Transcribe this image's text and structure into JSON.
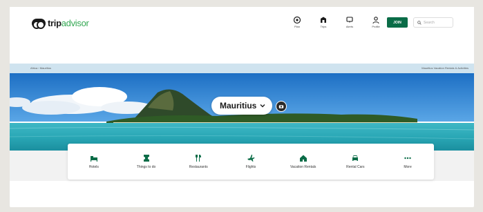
{
  "brand": {
    "name_main": "trip",
    "name_accent": "advisor"
  },
  "nav": [
    {
      "label": "Plan",
      "icon": "plan-icon"
    },
    {
      "label": "Trips",
      "icon": "trips-icon"
    },
    {
      "label": "Alerts",
      "icon": "alerts-icon"
    },
    {
      "label": "Profile",
      "icon": "profile-icon"
    }
  ],
  "join_label": "JOIN",
  "search_placeholder": "Search",
  "breadcrumb": "Africa › Mauritius",
  "breadcrumb_right": "Mauritius Vacation Rentals & Activities",
  "location": {
    "name": "Mauritius"
  },
  "categories": [
    {
      "label": "Hotels",
      "icon": "bed-icon"
    },
    {
      "label": "Things to do",
      "icon": "ticket-icon"
    },
    {
      "label": "Restaurants",
      "icon": "fork-knife-icon"
    },
    {
      "label": "Flights",
      "icon": "plane-icon"
    },
    {
      "label": "Vacation Rentals",
      "icon": "house-icon"
    },
    {
      "label": "Rental Cars",
      "icon": "car-icon"
    },
    {
      "label": "More",
      "icon": "more-icon"
    }
  ],
  "colors": {
    "brand_green": "#0a6c47",
    "crumb_bg": "#cfe3ef",
    "icon_green": "#0a6c47"
  }
}
